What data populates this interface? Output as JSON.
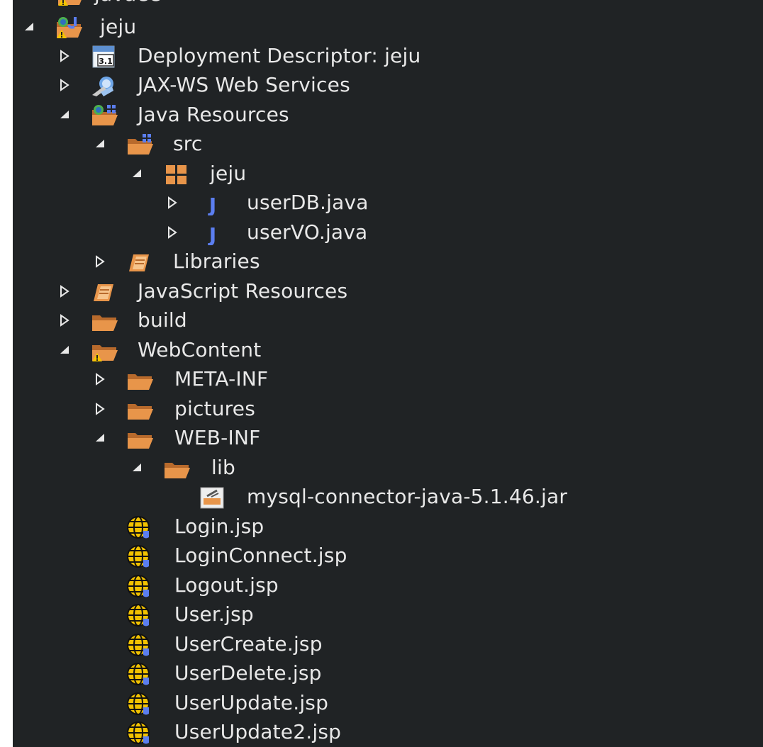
{
  "tree": {
    "items": [
      {
        "label": "javaee",
        "icon": "project-warning-icon",
        "state": "collapsed-clipped"
      },
      {
        "label": "jeju",
        "icon": "web-project-warning-icon",
        "state": "expanded"
      },
      {
        "label": "Deployment Descriptor: jeju",
        "icon": "deployment-descriptor-icon",
        "state": "collapsed",
        "badge": "3.1"
      },
      {
        "label": "JAX-WS Web Services",
        "icon": "web-services-icon",
        "state": "collapsed"
      },
      {
        "label": "Java Resources",
        "icon": "java-resources-icon",
        "state": "expanded"
      },
      {
        "label": "src",
        "icon": "source-folder-icon",
        "state": "expanded"
      },
      {
        "label": "jeju",
        "icon": "package-icon",
        "state": "expanded"
      },
      {
        "label": "userDB.java",
        "icon": "java-file-icon",
        "state": "collapsed",
        "glyph": "J"
      },
      {
        "label": "userVO.java",
        "icon": "java-file-icon",
        "state": "collapsed",
        "glyph": "J"
      },
      {
        "label": "Libraries",
        "icon": "library-icon",
        "state": "collapsed"
      },
      {
        "label": "JavaScript Resources",
        "icon": "library-icon",
        "state": "collapsed"
      },
      {
        "label": "build",
        "icon": "folder-icon",
        "state": "collapsed"
      },
      {
        "label": "WebContent",
        "icon": "folder-warning-icon",
        "state": "expanded"
      },
      {
        "label": "META-INF",
        "icon": "folder-icon",
        "state": "collapsed"
      },
      {
        "label": "pictures",
        "icon": "folder-icon",
        "state": "collapsed"
      },
      {
        "label": "WEB-INF",
        "icon": "folder-icon",
        "state": "expanded"
      },
      {
        "label": "lib",
        "icon": "folder-icon",
        "state": "expanded"
      },
      {
        "label": "mysql-connector-java-5.1.46.jar",
        "icon": "jar-file-icon",
        "state": "leaf"
      },
      {
        "label": "Login.jsp",
        "icon": "jsp-file-icon",
        "state": "leaf"
      },
      {
        "label": "LoginConnect.jsp",
        "icon": "jsp-file-icon",
        "state": "leaf"
      },
      {
        "label": "Logout.jsp",
        "icon": "jsp-file-icon",
        "state": "leaf"
      },
      {
        "label": "User.jsp",
        "icon": "jsp-file-icon",
        "state": "leaf"
      },
      {
        "label": "UserCreate.jsp",
        "icon": "jsp-file-icon",
        "state": "leaf"
      },
      {
        "label": "UserDelete.jsp",
        "icon": "jsp-file-icon",
        "state": "leaf"
      },
      {
        "label": "UserUpdate.jsp",
        "icon": "jsp-file-icon",
        "state": "leaf"
      },
      {
        "label": "UserUpdate2.jsp",
        "icon": "jsp-file-icon",
        "state": "leaf"
      }
    ]
  },
  "colors": {
    "background": "#202325",
    "text": "#e8e8e8",
    "folder": "#e8954a",
    "folder_dark": "#b86a2c",
    "java_blue": "#5b7ef0",
    "jsp_yellow": "#f2c200",
    "warning": "#f5c400"
  }
}
